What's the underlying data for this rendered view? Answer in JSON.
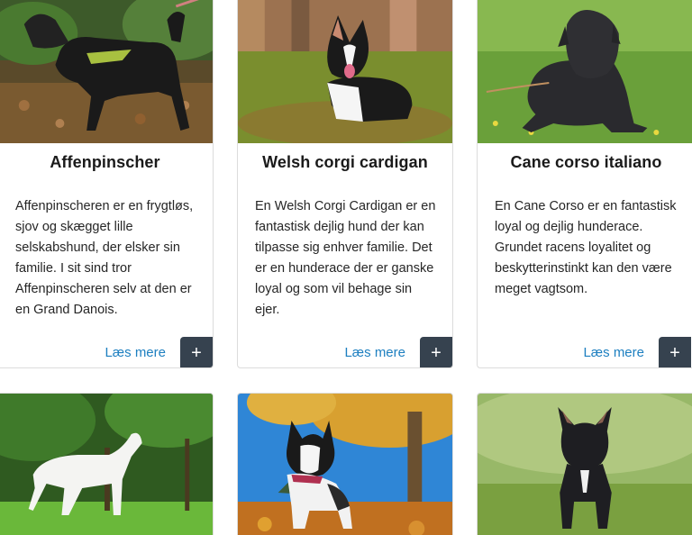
{
  "cards": [
    {
      "title": "Affenpinscher",
      "description": "Affenpinscheren er en frygtløs, sjov og skægget lille selskabshund, der elsker sin familie. I sit sind tror Affenpinscheren selv at den er en Grand Danois.",
      "link_label": "Læs mere",
      "button_icon": "+"
    },
    {
      "title": "Welsh corgi cardigan",
      "description": "En Welsh Corgi Cardigan er en fantastisk dejlig hund der kan tilpasse sig enhver familie. Det er en hunderace der er ganske loyal og som vil behage sin ejer.",
      "link_label": "Læs mere",
      "button_icon": "+"
    },
    {
      "title": "Cane corso italiano",
      "description": "En Cane Corso er en fantastisk loyal og dejlig hunderace. Grundet racens loyalitet og beskytterinstinkt kan den være meget vagtsom.",
      "link_label": "Læs mere",
      "button_icon": "+"
    }
  ],
  "colors": {
    "link": "#1d7fc0",
    "button_bg": "#36424f",
    "card_border": "#dcdcdc"
  },
  "icons": [
    "plus-icon",
    "dog-photo"
  ]
}
